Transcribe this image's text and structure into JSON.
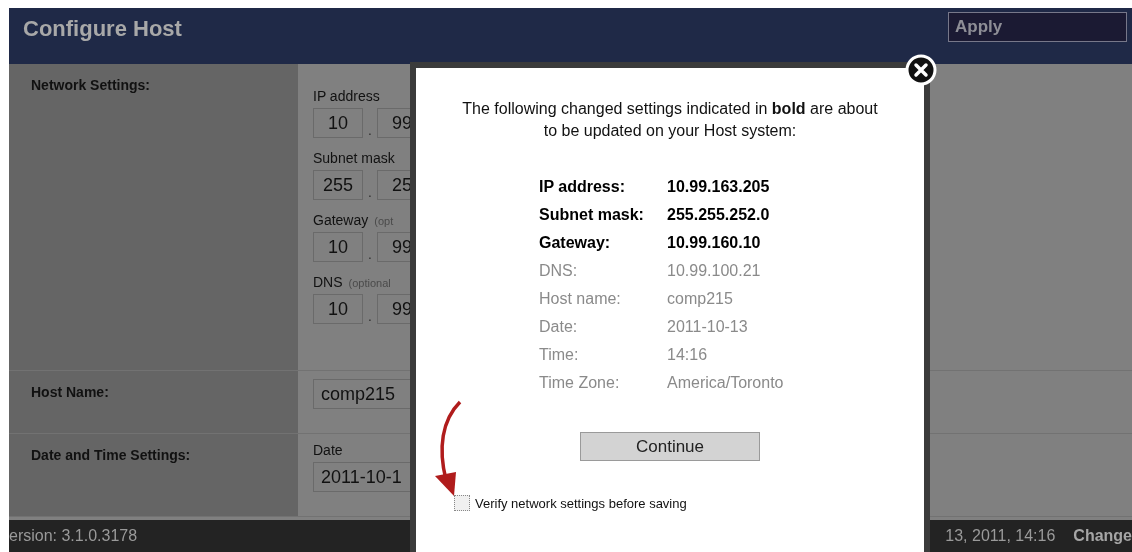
{
  "header": {
    "title": "Configure Host",
    "apply_button": "Apply"
  },
  "sections": [
    {
      "kind": "fields",
      "label": "Network Settings:",
      "fields": [
        {
          "label": "IP address",
          "separator": ".",
          "values": [
            "10",
            "99"
          ]
        },
        {
          "label": "Subnet mask",
          "separator": ".",
          "values": [
            "255",
            "25"
          ]
        },
        {
          "label": "Gateway",
          "hint": "(opt",
          "separator": ".",
          "values": [
            "10",
            "99"
          ]
        },
        {
          "label": "DNS",
          "hint": "(optional",
          "separator": ".",
          "values": [
            "10",
            "99"
          ]
        }
      ]
    },
    {
      "kind": "single",
      "label": "Host Name:",
      "fields": [
        {
          "values": [
            "comp215"
          ]
        }
      ]
    },
    {
      "kind": "fields",
      "label": "Date and Time Settings:",
      "fields": [
        {
          "label": "Date",
          "values": [
            "2011-10-1"
          ]
        }
      ]
    }
  ],
  "footer": {
    "version": "ersion: 3.1.0.3178",
    "datetime": "13, 2011, 14:16",
    "change_link": "Change"
  },
  "dialog": {
    "message": "The following changed settings indicated in **bold** are about to be updated on your Host system:",
    "summary": [
      {
        "label": "IP address:",
        "value": "10.99.163.205",
        "changed": true
      },
      {
        "label": "Subnet mask:",
        "value": "255.255.252.0",
        "changed": true
      },
      {
        "label": "Gateway:",
        "value": "10.99.160.10",
        "changed": true
      },
      {
        "label": "DNS:",
        "value": "10.99.100.21",
        "changed": false
      },
      {
        "label": "Host name:",
        "value": "comp215",
        "changed": false
      },
      {
        "label": "Date:",
        "value": "2011-10-13",
        "changed": false
      },
      {
        "label": "Time:",
        "value": "14:16",
        "changed": false
      },
      {
        "label": "Time Zone:",
        "value": "America/Toronto",
        "changed": false
      }
    ],
    "continue_button": "Continue",
    "verify": {
      "label": "Verify network settings before saving",
      "checked": false
    }
  }
}
